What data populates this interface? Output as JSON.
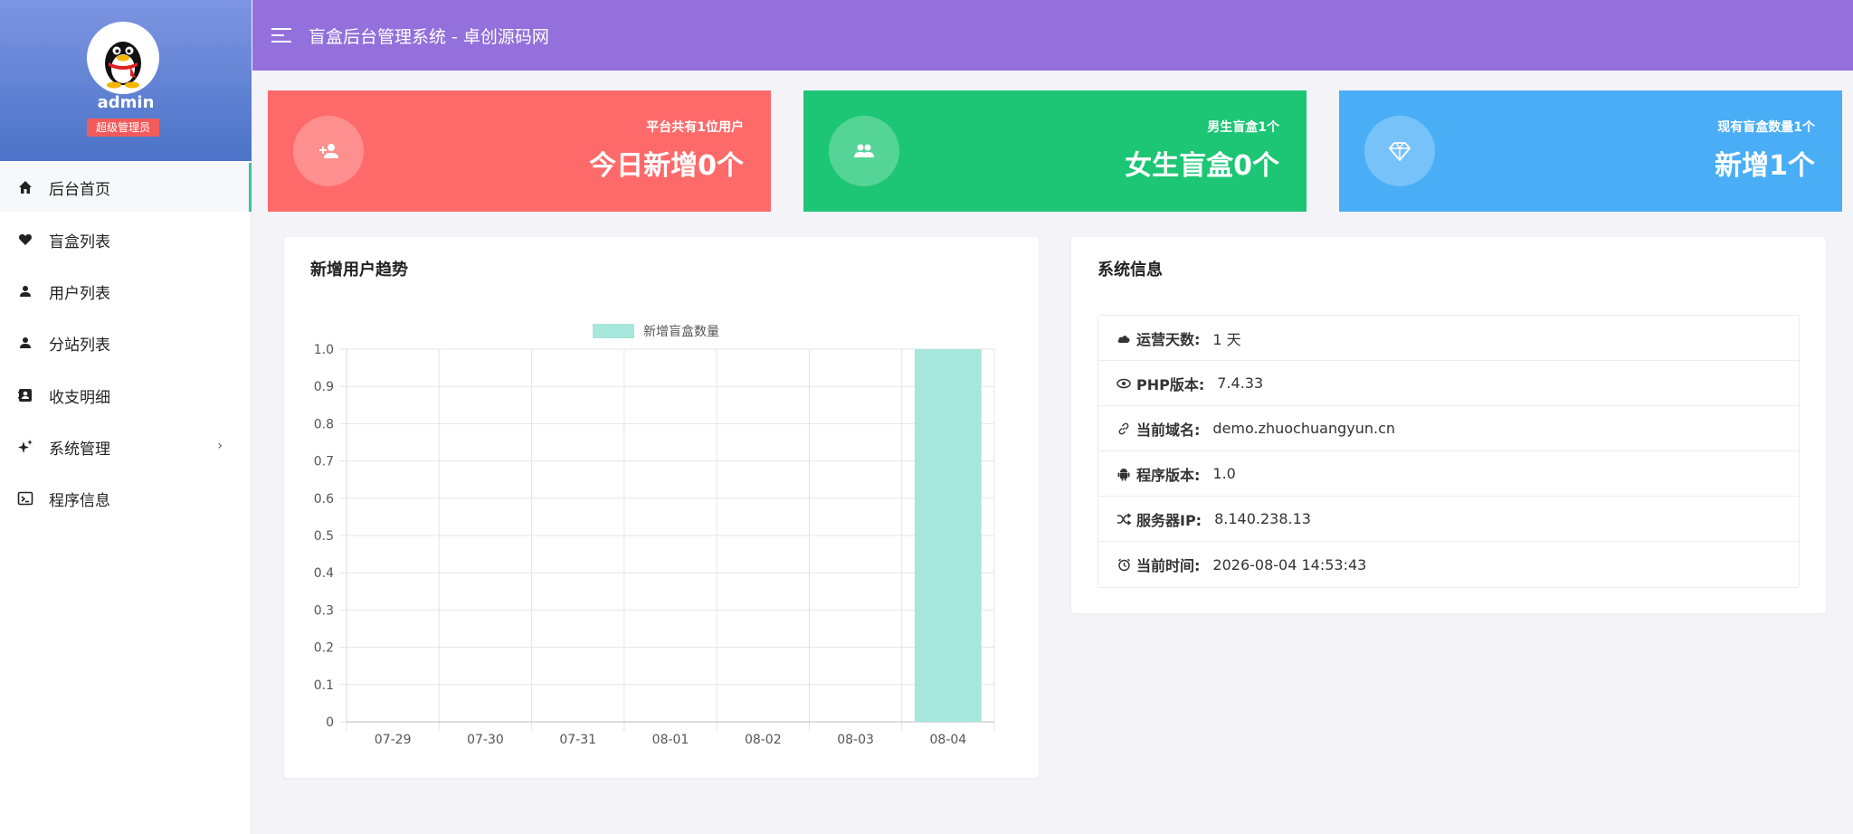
{
  "sidebar": {
    "username": "admin",
    "role": "超级管理员",
    "items": [
      {
        "label": "后台首页",
        "icon": "home-icon",
        "active": true
      },
      {
        "label": "盲盒列表",
        "icon": "heart-icon"
      },
      {
        "label": "用户列表",
        "icon": "user-icon"
      },
      {
        "label": "分站列表",
        "icon": "user-icon"
      },
      {
        "label": "收支明细",
        "icon": "contact-card-icon"
      },
      {
        "label": "系统管理",
        "icon": "sparkle-icon",
        "has_submenu": true
      },
      {
        "label": "程序信息",
        "icon": "terminal-icon"
      }
    ]
  },
  "header": {
    "title": "盲盒后台管理系统 - 卓创源码网"
  },
  "stats": [
    {
      "label": "平台共有1位用户",
      "value": "今日新增0个",
      "color": "#fe6a6a",
      "icon": "user-plus-icon"
    },
    {
      "label": "男生盲盒1个",
      "value": "女生盲盒0个",
      "color": "#1dc675",
      "icon": "user-group-icon"
    },
    {
      "label": "现有盲盒数量1个",
      "value": "新增1个",
      "color": "#4aaef7",
      "icon": "diamond-icon"
    }
  ],
  "trend_panel": {
    "title": "新增用户趋势"
  },
  "chart_data": {
    "type": "bar",
    "categories": [
      "07-29",
      "07-30",
      "07-31",
      "08-01",
      "08-02",
      "08-03",
      "08-04"
    ],
    "series": [
      {
        "name": "新增盲盒数量",
        "values": [
          0,
          0,
          0,
          0,
          0,
          0,
          1
        ],
        "color": "#a6e6db"
      }
    ],
    "yticks": [
      "0",
      "0.1",
      "0.2",
      "0.3",
      "0.4",
      "0.5",
      "0.6",
      "0.7",
      "0.8",
      "0.9",
      "1.0"
    ],
    "ylim": [
      0,
      1
    ],
    "grid": true,
    "legend": "top-center"
  },
  "system_panel": {
    "title": "系统信息",
    "rows": [
      {
        "label": "运营天数:",
        "value": "1 天",
        "icon": "cloud-icon"
      },
      {
        "label": "PHP版本:",
        "value": "7.4.33",
        "icon": "eye-icon"
      },
      {
        "label": "当前域名:",
        "value": "demo.zhuochuangyun.cn",
        "icon": "link-icon"
      },
      {
        "label": "程序版本:",
        "value": "1.0",
        "icon": "android-icon"
      },
      {
        "label": "服务器IP:",
        "value": "8.140.238.13",
        "icon": "shuffle-icon"
      },
      {
        "label": "当前时间:",
        "value": "2026-08-04 14:53:43",
        "icon": "clock-icon"
      }
    ]
  }
}
